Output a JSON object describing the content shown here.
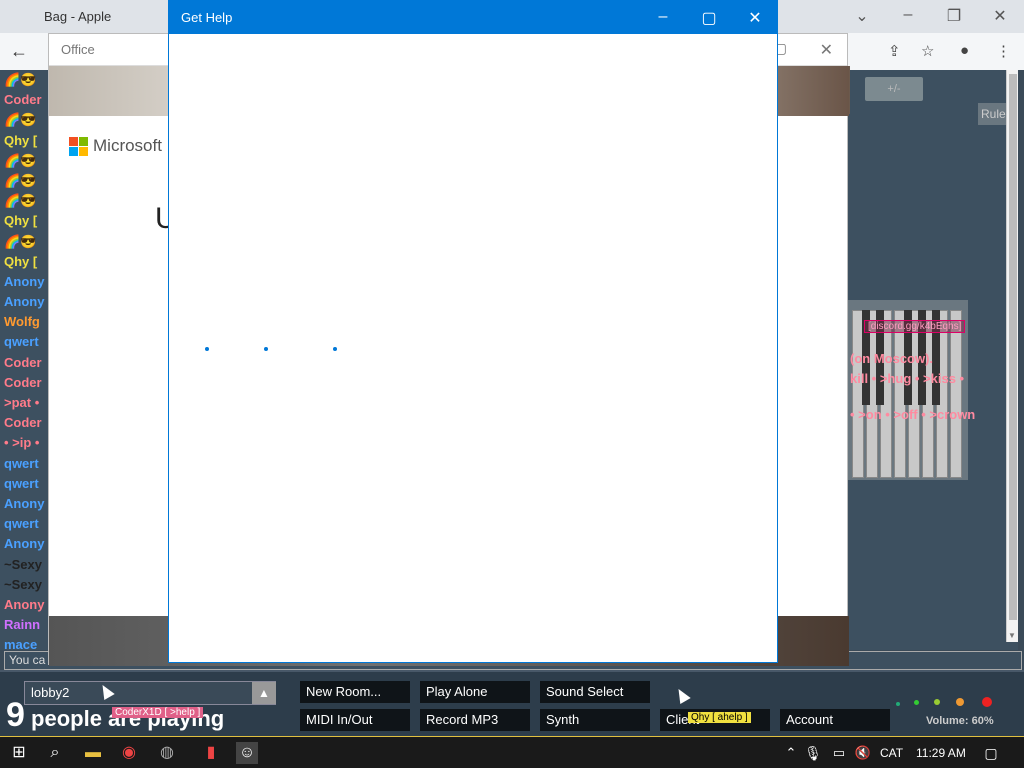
{
  "browser": {
    "tab_title": "Bag - Apple",
    "window_controls": [
      "chevron-down-icon",
      "minimize-icon",
      "restore-icon",
      "close-icon"
    ]
  },
  "chat": {
    "lines": [
      {
        "text": "🌈😎",
        "color": "#ffffff"
      },
      {
        "text": "Coder",
        "color": "#ff7b8a"
      },
      {
        "text": "🌈😎",
        "color": "#ffffff"
      },
      {
        "text": "Qhy [",
        "color": "#f0e040"
      },
      {
        "text": "🌈😎",
        "color": "#ffffff"
      },
      {
        "text": "🌈😎",
        "color": "#ffffff"
      },
      {
        "text": "🌈😎",
        "color": "#ffffff"
      },
      {
        "text": "Qhy [",
        "color": "#f0e040"
      },
      {
        "text": "🌈😎",
        "color": "#ffffff"
      },
      {
        "text": "Qhy [",
        "color": "#f0e040"
      },
      {
        "text": "Anony",
        "color": "#4aa0ff"
      },
      {
        "text": "Anony",
        "color": "#4aa0ff"
      },
      {
        "text": "Wolfg",
        "color": "#ff9a30"
      },
      {
        "text": "qwert",
        "color": "#4aa0ff"
      },
      {
        "text": "Coder",
        "color": "#ff7b8a"
      },
      {
        "text": "Coder",
        "color": "#ff7b8a"
      },
      {
        "text": ">pat •",
        "color": "#ff7b8a"
      },
      {
        "text": "Coder",
        "color": "#ff7b8a"
      },
      {
        "text": "• >ip •",
        "color": "#ff7b8a"
      },
      {
        "text": "qwert",
        "color": "#4aa0ff"
      },
      {
        "text": "qwert",
        "color": "#4aa0ff"
      },
      {
        "text": "Anony",
        "color": "#4aa0ff"
      },
      {
        "text": "qwert",
        "color": "#4aa0ff"
      },
      {
        "text": "Anony",
        "color": "#4aa0ff"
      },
      {
        "text": "~Sexy",
        "color": "#222222"
      },
      {
        "text": "~Sexy",
        "color": "#222222"
      },
      {
        "text": "Anony",
        "color": "#ff7b8a"
      },
      {
        "text": "Rainn",
        "color": "#d070ff"
      },
      {
        "text": "mace",
        "color": "#4aa0ff"
      }
    ],
    "input_placeholder": "You ca"
  },
  "room": {
    "rules_label": "Rule",
    "discord_tag": "[discord.gg/k4bEqhs]",
    "moscow_text": "(on Moscow).",
    "commands_line1": "kill • >hug • >kiss •",
    "commands_line2": "• >on • >off • >crown",
    "pill_label": "+/-"
  },
  "office": {
    "title": "Office",
    "brand": "Microsoft",
    "heading_fragment": "U"
  },
  "get_help": {
    "title": "Get Help"
  },
  "controls": {
    "room_name": "lobby2",
    "players_count": "9",
    "players_suffix": "people are playing",
    "pink_tag": "CoderX1D [ >help ]",
    "yellow_tag": "Qhy [ ahelp ]",
    "buttons_row1": [
      "New Room...",
      "Play Alone",
      "Sound Select"
    ],
    "buttons_row2": [
      "MIDI In/Out",
      "Record MP3",
      "Synth",
      "Client",
      "Account"
    ],
    "volume": "Volume: 60%"
  },
  "taskbar": {
    "language": "CAT",
    "time": "11:29 AM"
  },
  "colors": {
    "accent": "#0078d7",
    "taskbar_border": "#e0c040"
  }
}
